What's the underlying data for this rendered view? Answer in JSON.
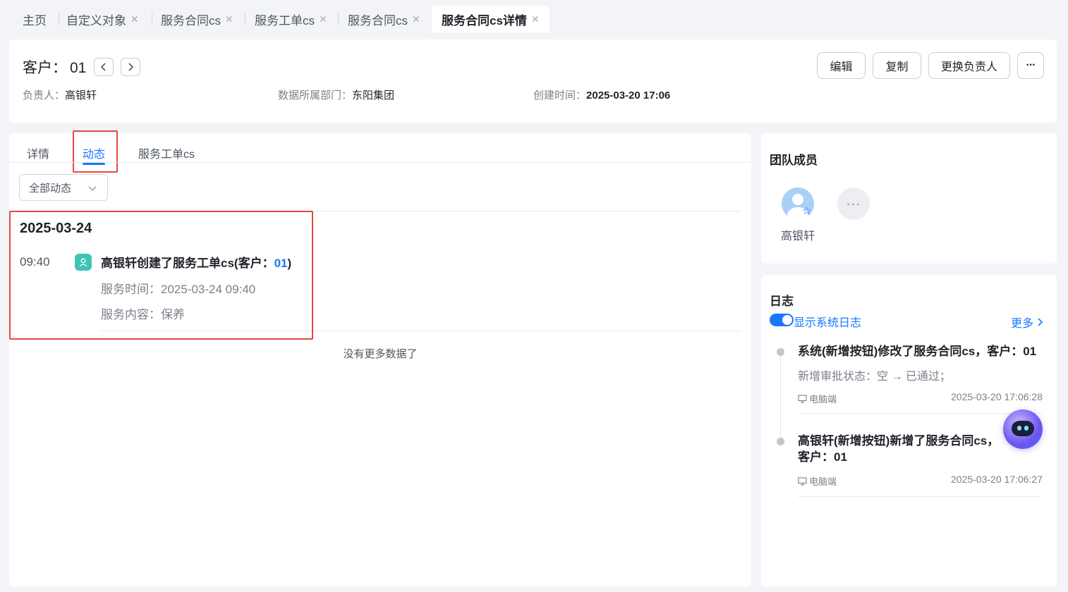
{
  "tabs": [
    {
      "label": "主页",
      "closable": false
    },
    {
      "label": "自定义对象",
      "closable": true
    },
    {
      "label": "服务合同cs",
      "closable": true
    },
    {
      "label": "服务工单cs",
      "closable": true
    },
    {
      "label": "服务合同cs",
      "closable": true
    },
    {
      "label": "服务合同cs详情",
      "closable": true,
      "active": true
    }
  ],
  "header": {
    "title": "客户：",
    "title_value": "01",
    "prev_icon": "chevron-left-icon",
    "next_icon": "chevron-right-icon",
    "owner_label": "负责人：",
    "owner_value": "高银轩",
    "dept_label": "数据所属部门：",
    "dept_value": "东阳集团",
    "created_label": "创建时间：",
    "created_value": "2025-03-20 17:06",
    "buttons": {
      "edit": "编辑",
      "copy": "复制",
      "change_owner": "更换负责人",
      "more": "···"
    }
  },
  "main": {
    "subtabs": [
      "详情",
      "动态",
      "服务工单cs"
    ],
    "active_subtab": "动态",
    "filter_value": "全部动态",
    "feed": {
      "date": "2025-03-24",
      "time": "09:40",
      "title_prefix": "高银轩创建了服务工单cs(客户：",
      "title_link": "01",
      "title_suffix": ")",
      "line1": "服务时间：2025-03-24 09:40",
      "line2": "服务内容：保养"
    },
    "no_more": "没有更多数据了"
  },
  "team": {
    "title": "团队成员",
    "members": [
      {
        "name": "高银轩"
      }
    ],
    "more": "···"
  },
  "log": {
    "title": "日志",
    "toggle_label": "显示系统日志",
    "more_label": "更多",
    "entries": [
      {
        "title": "系统(新增按钮)修改了服务合同cs，客户：01",
        "desc": "新增审批状态：空 → 已通过；",
        "source": "电脑端",
        "time": "2025-03-20 17:06:28"
      },
      {
        "title": "高银轩(新增按钮)新增了服务合同cs，客户：01",
        "source": "电脑端",
        "time": "2025-03-20 17:06:27"
      }
    ]
  },
  "colors": {
    "accent": "#1677ff",
    "highlight": "#e5483e",
    "feed_icon": "#3cc4b4"
  }
}
